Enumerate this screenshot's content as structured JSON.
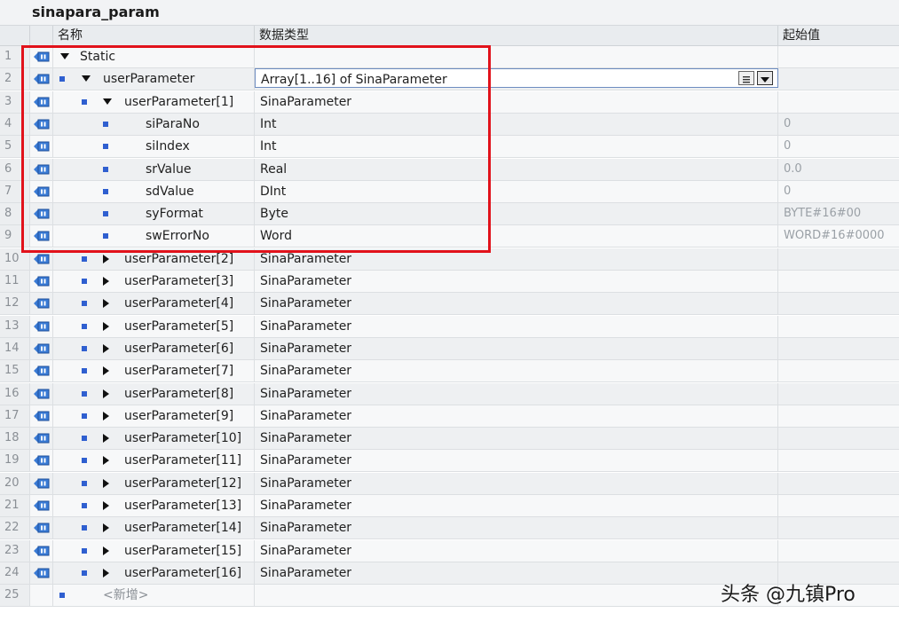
{
  "window": {
    "title": "sinapara_param"
  },
  "columns": {
    "name": "名称",
    "datatype": "数据类型",
    "start_value": "起始值"
  },
  "rows": [
    {
      "num": "1",
      "name": "Static",
      "type": "",
      "value": "",
      "level": 0,
      "expander": "down",
      "bullet": false
    },
    {
      "num": "2",
      "name": "userParameter",
      "type": "Array[1..16] of SinaParameter",
      "value": "",
      "level": 1,
      "expander": "down",
      "bullet": true,
      "editing": true
    },
    {
      "num": "3",
      "name": "userParameter[1]",
      "type": "SinaParameter",
      "value": "",
      "level": 2,
      "expander": "down",
      "bullet": true
    },
    {
      "num": "4",
      "name": "siParaNo",
      "type": "Int",
      "value": "0",
      "level": 3,
      "expander": "",
      "bullet": true
    },
    {
      "num": "5",
      "name": "siIndex",
      "type": "Int",
      "value": "0",
      "level": 3,
      "expander": "",
      "bullet": true
    },
    {
      "num": "6",
      "name": "srValue",
      "type": "Real",
      "value": "0.0",
      "level": 3,
      "expander": "",
      "bullet": true
    },
    {
      "num": "7",
      "name": "sdValue",
      "type": "DInt",
      "value": "0",
      "level": 3,
      "expander": "",
      "bullet": true
    },
    {
      "num": "8",
      "name": "syFormat",
      "type": "Byte",
      "value": "BYTE#16#00",
      "level": 3,
      "expander": "",
      "bullet": true
    },
    {
      "num": "9",
      "name": "swErrorNo",
      "type": "Word",
      "value": "WORD#16#0000",
      "level": 3,
      "expander": "",
      "bullet": true
    },
    {
      "num": "10",
      "name": "userParameter[2]",
      "type": "SinaParameter",
      "value": "",
      "level": 2,
      "expander": "right",
      "bullet": true
    },
    {
      "num": "11",
      "name": "userParameter[3]",
      "type": "SinaParameter",
      "value": "",
      "level": 2,
      "expander": "right",
      "bullet": true
    },
    {
      "num": "12",
      "name": "userParameter[4]",
      "type": "SinaParameter",
      "value": "",
      "level": 2,
      "expander": "right",
      "bullet": true
    },
    {
      "num": "13",
      "name": "userParameter[5]",
      "type": "SinaParameter",
      "value": "",
      "level": 2,
      "expander": "right",
      "bullet": true
    },
    {
      "num": "14",
      "name": "userParameter[6]",
      "type": "SinaParameter",
      "value": "",
      "level": 2,
      "expander": "right",
      "bullet": true
    },
    {
      "num": "15",
      "name": "userParameter[7]",
      "type": "SinaParameter",
      "value": "",
      "level": 2,
      "expander": "right",
      "bullet": true
    },
    {
      "num": "16",
      "name": "userParameter[8]",
      "type": "SinaParameter",
      "value": "",
      "level": 2,
      "expander": "right",
      "bullet": true
    },
    {
      "num": "17",
      "name": "userParameter[9]",
      "type": "SinaParameter",
      "value": "",
      "level": 2,
      "expander": "right",
      "bullet": true
    },
    {
      "num": "18",
      "name": "userParameter[10]",
      "type": "SinaParameter",
      "value": "",
      "level": 2,
      "expander": "right",
      "bullet": true
    },
    {
      "num": "19",
      "name": "userParameter[11]",
      "type": "SinaParameter",
      "value": "",
      "level": 2,
      "expander": "right",
      "bullet": true
    },
    {
      "num": "20",
      "name": "userParameter[12]",
      "type": "SinaParameter",
      "value": "",
      "level": 2,
      "expander": "right",
      "bullet": true
    },
    {
      "num": "21",
      "name": "userParameter[13]",
      "type": "SinaParameter",
      "value": "",
      "level": 2,
      "expander": "right",
      "bullet": true
    },
    {
      "num": "22",
      "name": "userParameter[14]",
      "type": "SinaParameter",
      "value": "",
      "level": 2,
      "expander": "right",
      "bullet": true
    },
    {
      "num": "23",
      "name": "userParameter[15]",
      "type": "SinaParameter",
      "value": "",
      "level": 2,
      "expander": "right",
      "bullet": true
    },
    {
      "num": "24",
      "name": "userParameter[16]",
      "type": "SinaParameter",
      "value": "",
      "level": 2,
      "expander": "right",
      "bullet": true
    },
    {
      "num": "25",
      "name": "<新增>",
      "type": "",
      "value": "",
      "level": 1,
      "expander": "",
      "bullet": true,
      "add": true
    }
  ],
  "icons": {
    "row_icon": "interface-io-icon",
    "expand_icon": "triangle-toggle-icon",
    "member_icon": "member-bullet-icon"
  },
  "colors": {
    "highlight_box": "#e1121b",
    "member_bullet": "#2f5fd0"
  },
  "watermark": "头条 @九镇Pro"
}
